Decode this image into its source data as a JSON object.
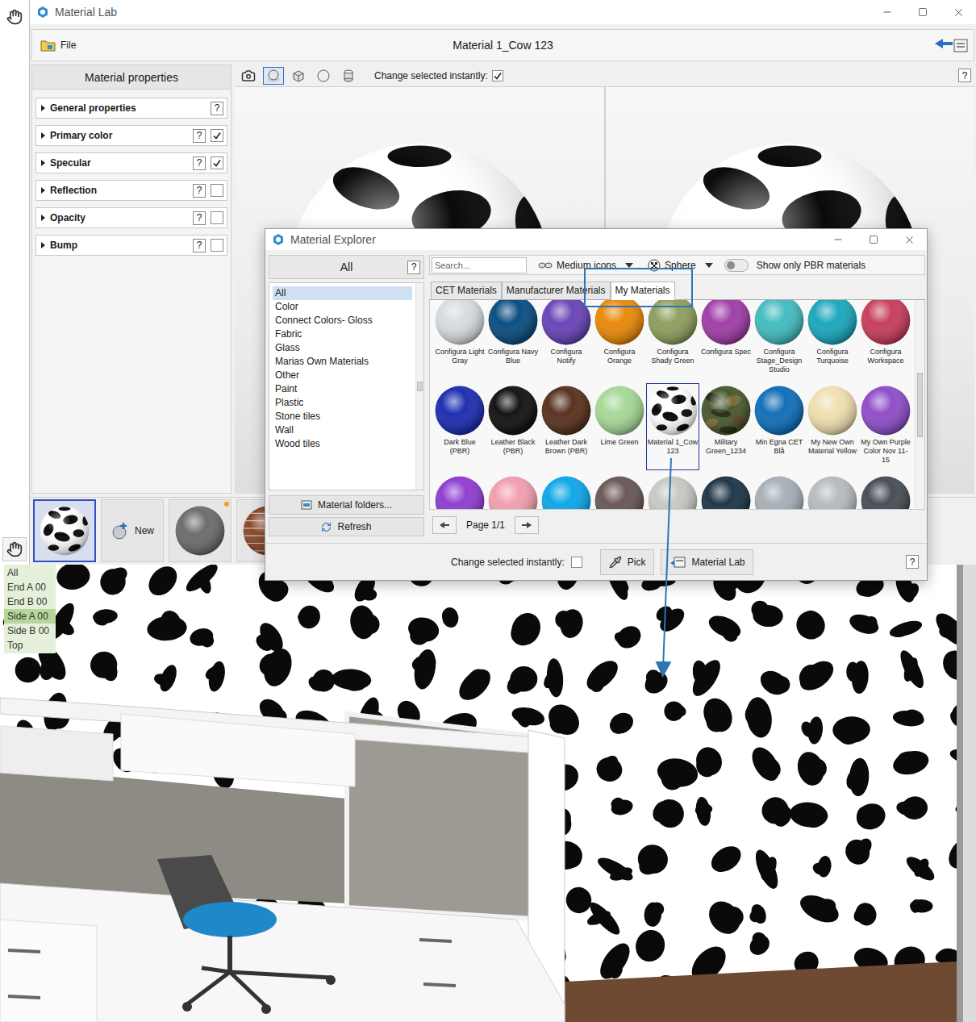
{
  "lab": {
    "title": "Material Lab",
    "file_button": "File",
    "material_name": "Material 1_Cow 123",
    "properties_header": "Material properties",
    "properties": [
      {
        "label": "General properties",
        "help": "?",
        "kind": "plain",
        "checked": false
      },
      {
        "label": "Primary color",
        "help": "?",
        "kind": "toggle",
        "checked": true
      },
      {
        "label": "Specular",
        "help": "?",
        "kind": "toggle",
        "checked": true
      },
      {
        "label": "Reflection",
        "help": "?",
        "kind": "toggle",
        "checked": false
      },
      {
        "label": "Opacity",
        "help": "?",
        "kind": "toggle",
        "checked": false
      },
      {
        "label": "Bump",
        "help": "?",
        "kind": "toggle",
        "checked": false
      }
    ],
    "preview": {
      "shapes": [
        {
          "kind": "camera",
          "selected": false
        },
        {
          "kind": "sphere-plane",
          "selected": true
        },
        {
          "kind": "cube",
          "selected": false
        },
        {
          "kind": "sphere",
          "selected": false
        },
        {
          "kind": "cylinder",
          "selected": false
        }
      ],
      "instant_label": "Change selected instantly:",
      "instant_checked": true,
      "help": "?"
    },
    "thumbnails": [
      {
        "kind": "cow",
        "color": "#ffffff",
        "selected": true,
        "badge": false
      },
      {
        "kind": "new",
        "label": "New",
        "color": "#9aa0a8",
        "selected": false,
        "badge": false
      },
      {
        "kind": "gray",
        "color": "#6e6e6e",
        "selected": false,
        "badge": true
      },
      {
        "kind": "brick",
        "color": "#8b4a2e",
        "selected": false,
        "badge": false
      }
    ]
  },
  "explorer": {
    "title": "Material Explorer",
    "category_header": "All",
    "help": "?",
    "categories": [
      {
        "label": "All",
        "selected": true
      },
      {
        "label": "Color",
        "selected": false
      },
      {
        "label": "Connect Colors- Gloss",
        "selected": false
      },
      {
        "label": "Fabric",
        "selected": false
      },
      {
        "label": "Glass",
        "selected": false
      },
      {
        "label": "Marias Own Materials",
        "selected": false
      },
      {
        "label": "Other",
        "selected": false
      },
      {
        "label": "Paint",
        "selected": false
      },
      {
        "label": "Plastic",
        "selected": false
      },
      {
        "label": "Stone tiles",
        "selected": false
      },
      {
        "label": "Wall",
        "selected": false
      },
      {
        "label": "Wood tiles",
        "selected": false
      }
    ],
    "folder_button": "Material folders...",
    "refresh_button": "Refresh",
    "search_placeholder": "Search...",
    "size_dropdown": "Medium icons",
    "shape_dropdown": "Sphere",
    "pbr_toggle": {
      "label": "Show only PBR materials",
      "on": false
    },
    "tabs": [
      {
        "label": "CET Materials",
        "selected": false
      },
      {
        "label": "Manufacturer Materials",
        "selected": false
      },
      {
        "label": "My Materials",
        "selected": true
      }
    ],
    "swatches": [
      {
        "label": "Configura Light Gray",
        "color": "#d8dcdf",
        "kind": "plain",
        "selected": false
      },
      {
        "label": "Configura Navy Blue",
        "color": "#0d4f82",
        "kind": "plain",
        "selected": false
      },
      {
        "label": "Configura Notify",
        "color": "#6a46b8",
        "kind": "plain",
        "selected": false
      },
      {
        "label": "Configura Orange",
        "color": "#e88a0c",
        "kind": "plain",
        "selected": false
      },
      {
        "label": "Configura Shady Green",
        "color": "#8fa060",
        "kind": "plain",
        "selected": false
      },
      {
        "label": "Configura Spec",
        "color": "#a040a8",
        "kind": "plain",
        "selected": false
      },
      {
        "label": "Configura Stage_Design Studio",
        "color": "#45bcc0",
        "kind": "plain",
        "selected": false
      },
      {
        "label": "Configura Turquoise",
        "color": "#1ea8bc",
        "kind": "plain",
        "selected": false
      },
      {
        "label": "Configura Workspace",
        "color": "#c8405e",
        "kind": "plain",
        "selected": false
      },
      {
        "label": "Dark Blue (PBR)",
        "color": "#2030b0",
        "kind": "plain",
        "selected": false
      },
      {
        "label": "Leather Black (PBR)",
        "color": "#151515",
        "kind": "plain",
        "selected": false
      },
      {
        "label": "Leather Dark Brown (PBR)",
        "color": "#5a3420",
        "kind": "plain",
        "selected": false
      },
      {
        "label": "Lime Green",
        "color": "#a8d898",
        "kind": "plain",
        "selected": false
      },
      {
        "label": "Material 1_Cow 123",
        "color": "#ffffff",
        "kind": "cow",
        "selected": true
      },
      {
        "label": "Military Green_1234",
        "color": "#4a5a30",
        "kind": "camo",
        "selected": false
      },
      {
        "label": "Min Egna CET Blå",
        "color": "#1470b8",
        "kind": "plain",
        "selected": false
      },
      {
        "label": "My New Own Material Yellow",
        "color": "#f0dfb0",
        "kind": "plain",
        "selected": false
      },
      {
        "label": "My Own Purple Color Nov 11-15",
        "color": "#9050c8",
        "kind": "plain",
        "selected": false
      },
      {
        "color": "#9040d0",
        "kind": "plain",
        "selected": false
      },
      {
        "color": "#f0a0b0",
        "kind": "plain",
        "selected": false
      },
      {
        "color": "#10a8e8",
        "kind": "plain",
        "selected": false
      },
      {
        "color": "#6a5a58",
        "kind": "plain",
        "selected": false
      },
      {
        "color": "#c8c8c4",
        "kind": "plain",
        "selected": false
      },
      {
        "color": "#203848",
        "kind": "plain",
        "selected": false
      },
      {
        "color": "#a8b0b8",
        "kind": "plain",
        "selected": false
      },
      {
        "color": "#b8bcc0",
        "kind": "plain",
        "selected": false
      },
      {
        "color": "#4a5058",
        "kind": "plain",
        "selected": false
      }
    ],
    "pager": "Page 1/1",
    "instant": {
      "label": "Change selected instantly:",
      "checked": false
    },
    "pick_button": "Pick",
    "lab_button": "Material Lab",
    "help_bottom": "?"
  },
  "scene": {
    "layers": [
      {
        "label": "All",
        "selected": false
      },
      {
        "label": "End A 00",
        "selected": false
      },
      {
        "label": "End B 00",
        "selected": false
      },
      {
        "label": "Side A 00",
        "selected": true
      },
      {
        "label": "Side B 00",
        "selected": false
      },
      {
        "label": "Top",
        "selected": false
      }
    ]
  }
}
